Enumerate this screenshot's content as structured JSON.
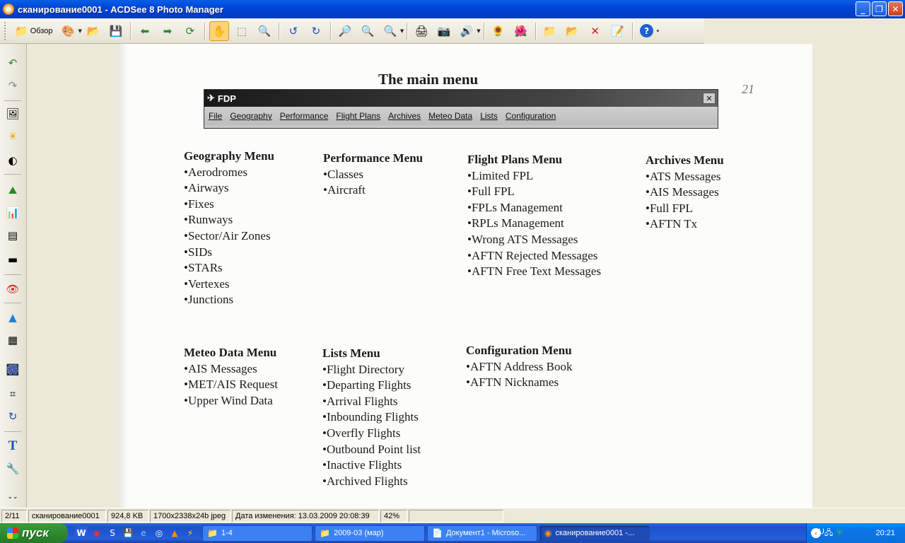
{
  "window": {
    "title": "сканирование0001 - ACDSee 8 Photo Manager"
  },
  "toolbar": {
    "browse_label": "Обзор"
  },
  "document": {
    "title": "The main menu",
    "pencil_mark": "21",
    "fdp_window": {
      "title": "FDP",
      "close": "✕",
      "menu": [
        "File",
        "Geography",
        "Performance",
        "Flight Plans",
        "Archives",
        "Meteo Data",
        "Lists",
        "Configuration"
      ]
    },
    "menus": [
      {
        "heading": "Geography Menu",
        "items": [
          "Aerodromes",
          "Airways",
          "Fixes",
          "Runways",
          "Sector/Air Zones",
          "SIDs",
          "STARs",
          "Vertexes",
          "Junctions"
        ]
      },
      {
        "heading": "Performance Menu",
        "items": [
          "Classes",
          "Aircraft"
        ]
      },
      {
        "heading": "Flight Plans Menu",
        "items": [
          "Limited FPL",
          "Full FPL",
          "FPLs Management",
          "RPLs Management",
          "Wrong ATS Messages",
          "AFTN Rejected Messages",
          "AFTN Free Text Messages"
        ]
      },
      {
        "heading": "Archives Menu",
        "items": [
          "ATS Messages",
          "AIS Messages",
          "Full FPL",
          "AFTN Tx"
        ]
      },
      {
        "heading": "Meteo Data Menu",
        "items": [
          "AIS Messages",
          "MET/AIS Request",
          "Upper Wind Data"
        ]
      },
      {
        "heading": "Lists Menu",
        "items": [
          "Flight Directory",
          "Departing Flights",
          "Arrival Flights",
          "Inbounding Flights",
          "Overfly Flights",
          "Outbound Point list",
          "Inactive Flights",
          "Archived Flights"
        ]
      },
      {
        "heading": "Configuration Menu",
        "items": [
          "AFTN Address Book",
          "AFTN Nicknames"
        ]
      }
    ]
  },
  "statusbar": {
    "position": "2/11",
    "filename": "сканирование0001",
    "filesize": "924,8 KB",
    "dimensions": "1700x2338x24b jpeg",
    "modified": "Дата изменения: 13.03.2009 20:08:39",
    "zoom": "42%"
  },
  "taskbar": {
    "start_label": "пуск",
    "tasks": [
      {
        "label": "1-4",
        "icon": "folder-icon"
      },
      {
        "label": "2009-03 (мар)",
        "icon": "folder-icon"
      },
      {
        "label": "Документ1 - Microso...",
        "icon": "word-icon"
      },
      {
        "label": "сканирование0001 -...",
        "icon": "acdsee-icon"
      }
    ],
    "language": "RU",
    "clock": "20:21"
  }
}
